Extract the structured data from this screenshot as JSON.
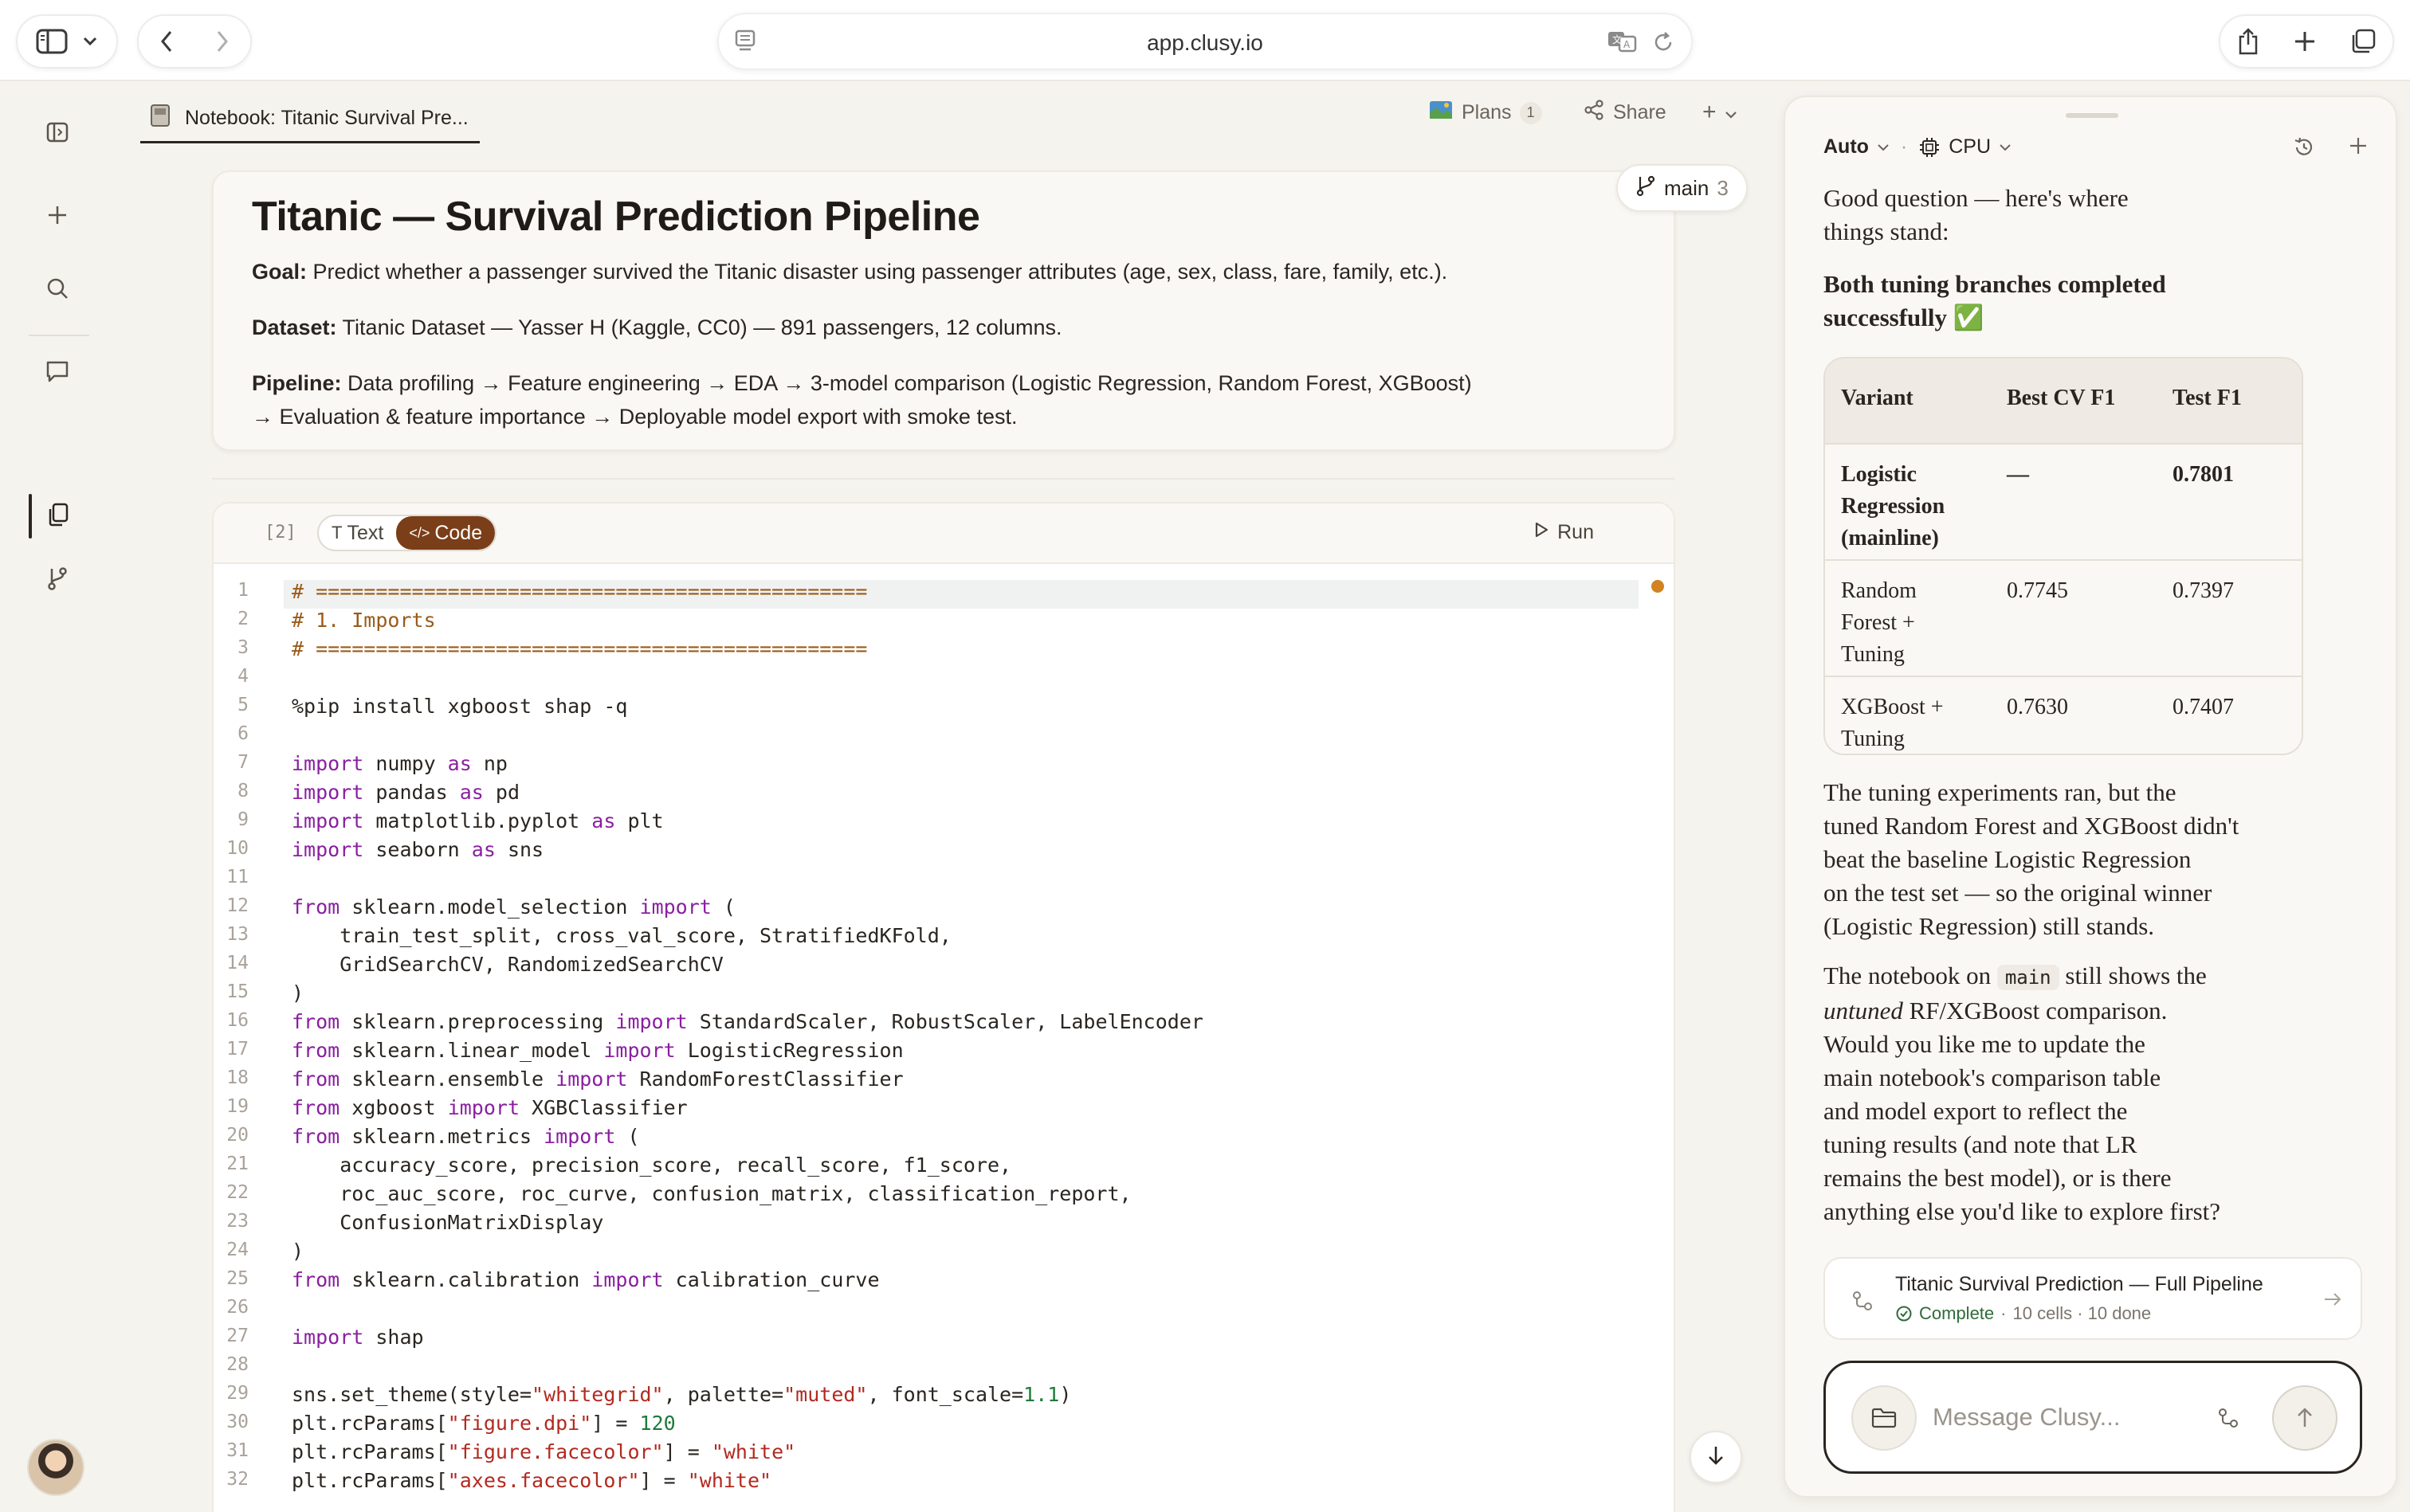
{
  "browser": {
    "url": "app.clusy.io"
  },
  "notebook": {
    "tab_title": "Notebook: Titanic Survival Pre...",
    "plans_label": "Plans",
    "plans_count": "1",
    "share_label": "Share",
    "add_label": "+",
    "branch_name": "main",
    "branch_count": "3"
  },
  "intro": {
    "title": "Titanic — Survival Prediction Pipeline",
    "goal_label": "Goal:",
    "goal_text": " Predict whether a passenger survived the Titanic disaster using passenger attributes (age, sex, class, fare, family, etc.).",
    "dataset_label": "Dataset:",
    "dataset_text": " Titanic Dataset — Yasser H (Kaggle, CC0) — 891 passengers, 12 columns.",
    "pipeline_label": "Pipeline:",
    "pipeline_text_1": " Data profiling → Feature engineering → EDA → 3-model comparison (Logistic Regression, Random Forest, XGBoost)",
    "pipeline_text_2": "→ Evaluation & feature importance → Deployable model export with smoke test."
  },
  "cell": {
    "number": "[2]",
    "text_toggle": "Text",
    "code_toggle": "Code",
    "run_label": "Run"
  },
  "code_lines": [
    {
      "n": "1",
      "html": "<span class=\"cm\"># ==============================================</span>"
    },
    {
      "n": "2",
      "html": "<span class=\"cm\"># 1. Imports</span>"
    },
    {
      "n": "3",
      "html": "<span class=\"cm\"># ==============================================</span>"
    },
    {
      "n": "4",
      "html": ""
    },
    {
      "n": "5",
      "html": "%pip install xgboost shap -q"
    },
    {
      "n": "6",
      "html": ""
    },
    {
      "n": "7",
      "html": "<span class=\"kw\">import</span> numpy <span class=\"kw\">as</span> np"
    },
    {
      "n": "8",
      "html": "<span class=\"kw\">import</span> pandas <span class=\"kw\">as</span> pd"
    },
    {
      "n": "9",
      "html": "<span class=\"kw\">import</span> matplotlib.pyplot <span class=\"kw\">as</span> plt"
    },
    {
      "n": "10",
      "html": "<span class=\"kw\">import</span> seaborn <span class=\"kw\">as</span> sns"
    },
    {
      "n": "11",
      "html": ""
    },
    {
      "n": "12",
      "html": "<span class=\"kw\">from</span> sklearn.model_selection <span class=\"kw\">import</span> ("
    },
    {
      "n": "13",
      "html": "    train_test_split, cross_val_score, StratifiedKFold,"
    },
    {
      "n": "14",
      "html": "    GridSearchCV, RandomizedSearchCV"
    },
    {
      "n": "15",
      "html": ")"
    },
    {
      "n": "16",
      "html": "<span class=\"kw\">from</span> sklearn.preprocessing <span class=\"kw\">import</span> StandardScaler, RobustScaler, LabelEncoder"
    },
    {
      "n": "17",
      "html": "<span class=\"kw\">from</span> sklearn.linear_model <span class=\"kw\">import</span> LogisticRegression"
    },
    {
      "n": "18",
      "html": "<span class=\"kw\">from</span> sklearn.ensemble <span class=\"kw\">import</span> RandomForestClassifier"
    },
    {
      "n": "19",
      "html": "<span class=\"kw\">from</span> xgboost <span class=\"kw\">import</span> XGBClassifier"
    },
    {
      "n": "20",
      "html": "<span class=\"kw\">from</span> sklearn.metrics <span class=\"kw\">import</span> ("
    },
    {
      "n": "21",
      "html": "    accuracy_score, precision_score, recall_score, f1_score,"
    },
    {
      "n": "22",
      "html": "    roc_auc_score, roc_curve, confusion_matrix, classification_report,"
    },
    {
      "n": "23",
      "html": "    ConfusionMatrixDisplay"
    },
    {
      "n": "24",
      "html": ")"
    },
    {
      "n": "25",
      "html": "<span class=\"kw\">from</span> sklearn.calibration <span class=\"kw\">import</span> calibration_curve"
    },
    {
      "n": "26",
      "html": ""
    },
    {
      "n": "27",
      "html": "<span class=\"kw\">import</span> shap"
    },
    {
      "n": "28",
      "html": ""
    },
    {
      "n": "29",
      "html": "sns.set_theme(style=<span class=\"st\">\"whitegrid\"</span>, palette=<span class=\"st\">\"muted\"</span>, font_scale=<span class=\"nm\">1.1</span>)"
    },
    {
      "n": "30",
      "html": "plt.rcParams[<span class=\"st\">\"figure.dpi\"</span>] = <span class=\"nm\">120</span>"
    },
    {
      "n": "31",
      "html": "plt.rcParams[<span class=\"st\">\"figure.facecolor\"</span>] = <span class=\"st\">\"white\"</span>"
    },
    {
      "n": "32",
      "html": "plt.rcParams[<span class=\"st\">\"axes.facecolor\"</span>] = <span class=\"st\">\"white\"</span>"
    }
  ],
  "chat": {
    "mode": "Auto",
    "compute": "CPU",
    "intro_1": "Good question — here's where",
    "intro_2": "things stand:",
    "headline_1": "Both tuning branches completed",
    "headline_2": "successfully ✅",
    "table": {
      "headers": [
        "Variant",
        "Best CV F1",
        "Test F1"
      ],
      "rows": [
        {
          "variant": [
            "Logistic",
            "Regression",
            "(mainline)"
          ],
          "cv": "—",
          "test": "0.7801",
          "bold": true
        },
        {
          "variant": [
            "Random",
            "Forest +",
            "Tuning"
          ],
          "cv": "0.7745",
          "test": "0.7397",
          "bold": false
        },
        {
          "variant": [
            "XGBoost +",
            "Tuning"
          ],
          "cv": "0.7630",
          "test": "0.7407",
          "bold": false
        }
      ]
    },
    "para1": [
      "The tuning experiments ran, but the",
      "tuned Random Forest and XGBoost didn't",
      "beat the baseline Logistic Regression",
      "on the test set — so the original winner",
      "(Logistic Regression) still stands."
    ],
    "para2_pre": "The notebook on ",
    "para2_code": "main",
    "para2_post": " still shows the",
    "para2_em": "untuned",
    "para2_em_rest": " RF/XGBoost comparison.",
    "para2_lines": [
      "Would you like me to update the",
      "main notebook's comparison table",
      "and model export to reflect the",
      "tuning results (and note that LR",
      "remains the best model), or is there",
      "anything else you'd like to explore first?"
    ],
    "plan_title": "Titanic Survival Prediction — Full Pipeline",
    "plan_status": "Complete",
    "plan_meta": "10 cells · 10 done",
    "composer_placeholder": "Message Clusy..."
  },
  "colors": {
    "accent": "#7a3e18",
    "keyword": "#8a1fa0",
    "comment": "#9a5b1a",
    "string": "#b22a20",
    "number": "#1e7a3a",
    "status_ok": "#2e6b3a",
    "unsaved_dot": "#d2831f"
  }
}
